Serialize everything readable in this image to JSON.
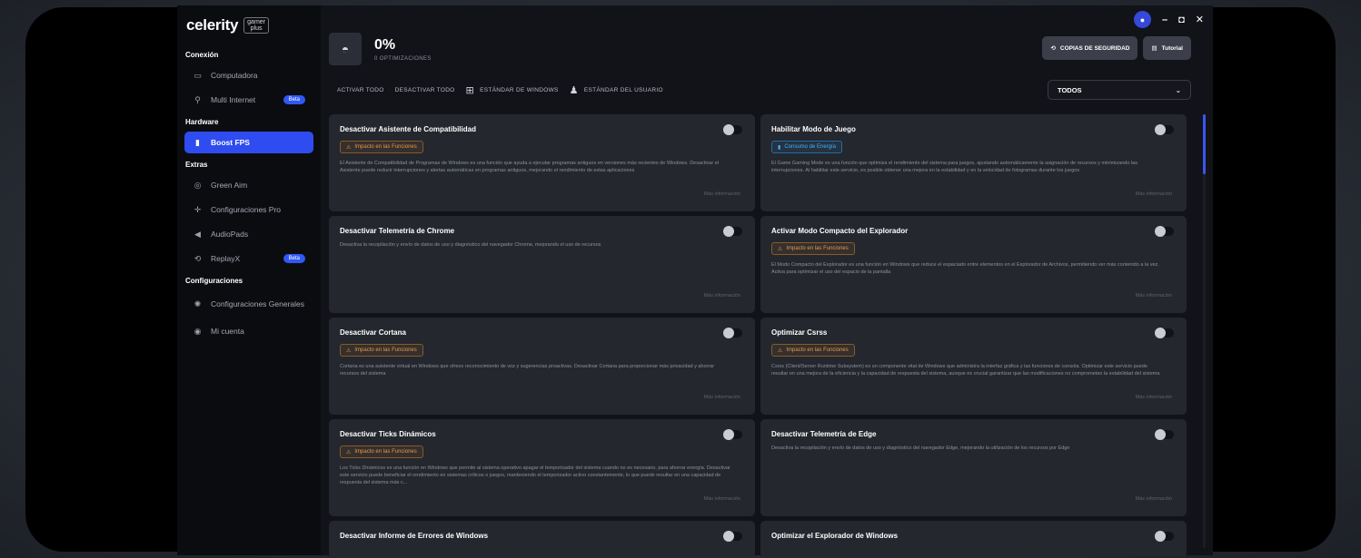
{
  "brand": {
    "name": "celerity",
    "tag_line1": "gamer",
    "tag_line2": "plus"
  },
  "sidebar": {
    "sections": [
      {
        "title": "Conexión",
        "items": [
          {
            "label": "Computadora",
            "icon": "monitor-icon",
            "glyph": "▭"
          },
          {
            "label": "Multi Internet",
            "icon": "antenna-icon",
            "glyph": "⚲",
            "badge": "Beta"
          }
        ]
      },
      {
        "title": "Hardware",
        "items": [
          {
            "label": "Boost FPS",
            "icon": "bars-icon",
            "glyph": "▮",
            "active": true
          }
        ]
      },
      {
        "title": "Extras",
        "items": [
          {
            "label": "Green Aim",
            "icon": "target-icon",
            "glyph": "◎"
          },
          {
            "label": "Configuraciones Pro",
            "icon": "crosshair-icon",
            "glyph": "✛"
          },
          {
            "label": "AudioPads",
            "icon": "speaker-icon",
            "glyph": "◀"
          },
          {
            "label": "ReplayX",
            "icon": "replay-icon",
            "glyph": "⟲",
            "badge": "Beta"
          }
        ]
      },
      {
        "title": "Configuraciones",
        "items": [
          {
            "label": "Configuraciones Generales",
            "icon": "settings-icon",
            "glyph": "✺"
          },
          {
            "label": "Mi cuenta",
            "icon": "account-icon",
            "glyph": "◉"
          }
        ]
      }
    ]
  },
  "header": {
    "percent": "0%",
    "optimizations": "0 OPTIMIZACIONES"
  },
  "actions": {
    "backup": "COPIAS DE SEGURIDAD",
    "tutorial": "Tutorial"
  },
  "filters": {
    "activate_all": "ACTIVAR TODO",
    "deactivate_all": "DESACTIVAR TODO",
    "windows_standard": "ESTÁNDAR DE WINDOWS",
    "user_standard": "ESTÁNDAR DEL USUARIO",
    "select_value": "TODOS"
  },
  "more_info": "Más información",
  "cards": [
    {
      "title": "Desactivar Asistente de Compatibilidad",
      "badge": "Impacto en las Funciones",
      "badge_type": "warn",
      "desc": "El Asistente de Compatibilidad de Programas de Windows es una función que ayuda a ejecutar programas antiguos en versiones más recientes de Windows. Desactivar el Asistente puede reducir interrupciones y alertas automáticas en programas antiguos, mejorando el rendimiento de estas aplicaciones"
    },
    {
      "title": "Habilitar Modo de Juego",
      "badge": "Consumo de Energía",
      "badge_type": "info",
      "desc": "El Game Gaming Mode es una función que optimiza el rendimiento del sistema para juegos, ajustando automáticamente la asignación de recursos y minimizando las interrupciones. Al habilitar este servicio, es posible obtener una mejora en la estabilidad y en la velocidad de fotogramas durante los juegos"
    },
    {
      "title": "Desactivar Telemetría de Chrome",
      "badge": "",
      "badge_type": "",
      "desc": "Desactiva la recopilación y envío de datos de uso y diagnóstico del navegador Chrome, mejorando el uso de recursos"
    },
    {
      "title": "Activar Modo Compacto del Explorador",
      "badge": "Impacto en las Funciones",
      "badge_type": "warn",
      "desc": "El Modo Compacto del Explorador es una función en Windows que reduce el espaciado entre elementos en el Explorador de Archivos, permitiendo ver más contenido a la vez. Activa para optimizar el uso del espacio de la pantalla"
    },
    {
      "title": "Desactivar Cortana",
      "badge": "Impacto en las Funciones",
      "badge_type": "warn",
      "desc": "Cortana es una asistente virtual en Windows que ofrece reconocimiento de voz y sugerencias proactivas. Desactivar Cortana para proporcionar más privacidad y ahorrar recursos del sistema"
    },
    {
      "title": "Optimizar Csrss",
      "badge": "Impacto en las Funciones",
      "badge_type": "warn",
      "desc": "Csrss (Client/Server Runtime Subsystem) es un componente vital de Windows que administra la interfaz gráfica y las funciones de consola. Optimizar este servicio puede resultar en una mejora de la eficiencia y la capacidad de respuesta del sistema, aunque es crucial garantizar que las modificaciones no comprometan la estabilidad del sistema"
    },
    {
      "title": "Desactivar Ticks Dinámicos",
      "badge": "Impacto en las Funciones",
      "badge_type": "warn",
      "desc": "Los Ticks Dinámicos es una función en Windows que permite al sistema operativo apagar el temporizador del sistema cuando no es necesario, para ahorrar energía. Desactivar este servicio puede beneficiar el rendimiento en sistemas críticos o juegos, manteniendo el temporizador activo constantemente, lo que puede resultar en una capacidad de respuesta del sistema más c..."
    },
    {
      "title": "Desactivar Telemetría de Edge",
      "badge": "",
      "badge_type": "",
      "desc": "Desactiva la recopilación y envío de datos de uso y diagnóstico del navegador Edge, mejorando la utilización de los recursos por Edge"
    },
    {
      "title": "Desactivar Informe de Errores de Windows",
      "badge": "",
      "badge_type": "",
      "desc": ""
    },
    {
      "title": "Optimizar el Explorador de Windows",
      "badge": "",
      "badge_type": "",
      "desc": ""
    }
  ],
  "scroll": {
    "position_fraction": 0.0
  }
}
